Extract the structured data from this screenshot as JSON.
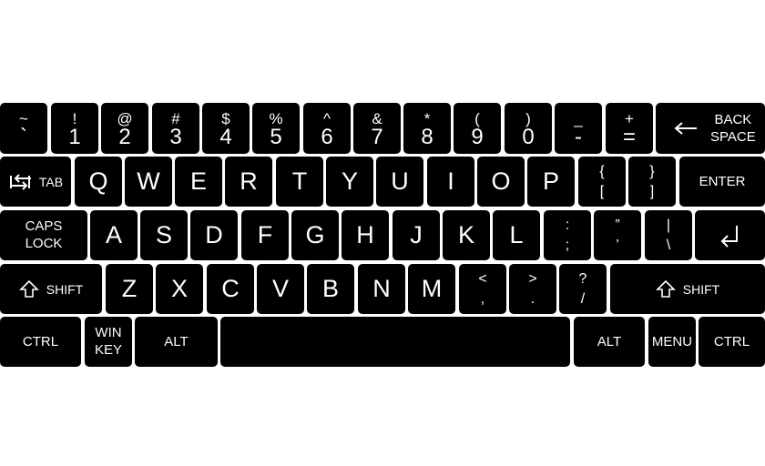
{
  "row1": [
    {
      "top": "~",
      "bottom": "`"
    },
    {
      "top": "!",
      "bottom": "1"
    },
    {
      "top": "@",
      "bottom": "2"
    },
    {
      "top": "#",
      "bottom": "3"
    },
    {
      "top": "$",
      "bottom": "4"
    },
    {
      "top": "%",
      "bottom": "5"
    },
    {
      "top": "^",
      "bottom": "6"
    },
    {
      "top": "&",
      "bottom": "7"
    },
    {
      "top": "*",
      "bottom": "8"
    },
    {
      "top": "(",
      "bottom": "9"
    },
    {
      "top": ")",
      "bottom": "0"
    },
    {
      "top": "_",
      "bottom": "-"
    },
    {
      "top": "+",
      "bottom": "="
    }
  ],
  "backspace": {
    "line1": "BACK",
    "line2": "SPACE"
  },
  "tab": {
    "label": "TAB"
  },
  "row2_letters": [
    "Q",
    "W",
    "E",
    "R",
    "T",
    "Y",
    "U",
    "I",
    "O",
    "P"
  ],
  "brace_left": {
    "top": "{",
    "bottom": "["
  },
  "brace_right": {
    "top": "}",
    "bottom": "]"
  },
  "enter": {
    "label": "ENTER"
  },
  "caps": {
    "line1": "CAPS",
    "line2": "LOCK"
  },
  "row3_letters": [
    "A",
    "S",
    "D",
    "F",
    "G",
    "H",
    "J",
    "K",
    "L"
  ],
  "colon": {
    "top": ":",
    "bottom": ";"
  },
  "quote": {
    "top": "”",
    "bottom": "’"
  },
  "pipe": {
    "top": "|",
    "bottom": "\\"
  },
  "shift_left": {
    "label": "SHIFT"
  },
  "row4_letters": [
    "Z",
    "X",
    "C",
    "V",
    "B",
    "N",
    "M"
  ],
  "angle_left": {
    "top": "<",
    "bottom": ","
  },
  "angle_right": {
    "top": ">",
    "bottom": "."
  },
  "question": {
    "top": "?",
    "bottom": "/"
  },
  "shift_right": {
    "label": "SHIFT"
  },
  "ctrl_left": {
    "label": "CTRL"
  },
  "win": {
    "line1": "WIN",
    "line2": "KEY"
  },
  "alt_left": {
    "label": "ALT"
  },
  "space": {
    "label": ""
  },
  "alt_right": {
    "label": "ALT"
  },
  "menu": {
    "label": "MENU"
  },
  "ctrl_right": {
    "label": "CTRL"
  },
  "colors": {
    "key": "#000000",
    "legend": "#ffffff",
    "background": "#ffffff"
  }
}
